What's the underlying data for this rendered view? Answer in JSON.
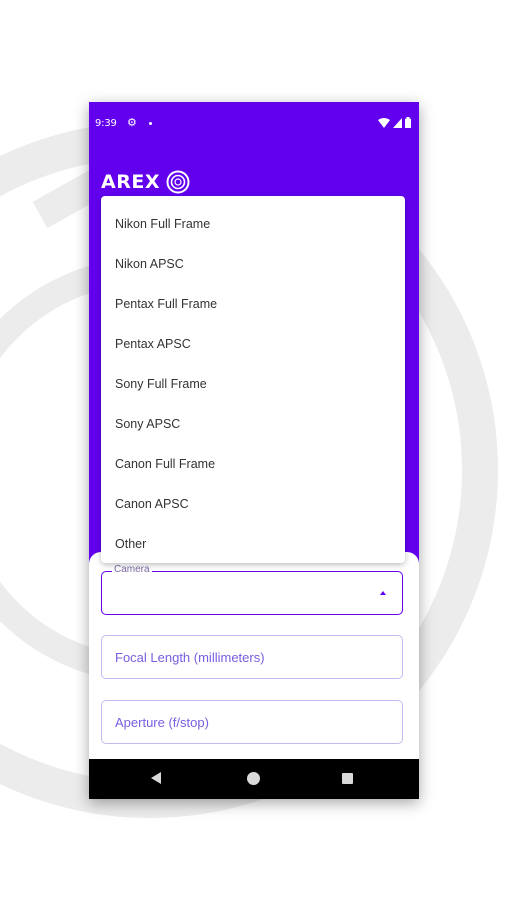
{
  "status_bar": {
    "time": "9:39"
  },
  "app": {
    "logo_text": "AREX"
  },
  "camera_dropdown": {
    "options": [
      "Nikon Full Frame",
      "Nikon APSC",
      "Pentax Full Frame",
      "Pentax APSC",
      "Sony Full Frame",
      "Sony APSC",
      "Canon Full Frame",
      "Canon APSC",
      "Other"
    ]
  },
  "form": {
    "camera_label": "Camera",
    "camera_value": "",
    "focal_length_placeholder": "Focal Length (millimeters)",
    "aperture_placeholder": "Aperture (f/stop)"
  },
  "colors": {
    "primary": "#6200ee",
    "navbar": "#000000"
  },
  "icons": {
    "status_left": [
      "settings-icon",
      "notification-dot-icon"
    ],
    "status_right": [
      "wifi-icon",
      "signal-icon",
      "battery-icon"
    ],
    "navigation": [
      "back-icon",
      "home-icon",
      "recents-icon"
    ]
  }
}
